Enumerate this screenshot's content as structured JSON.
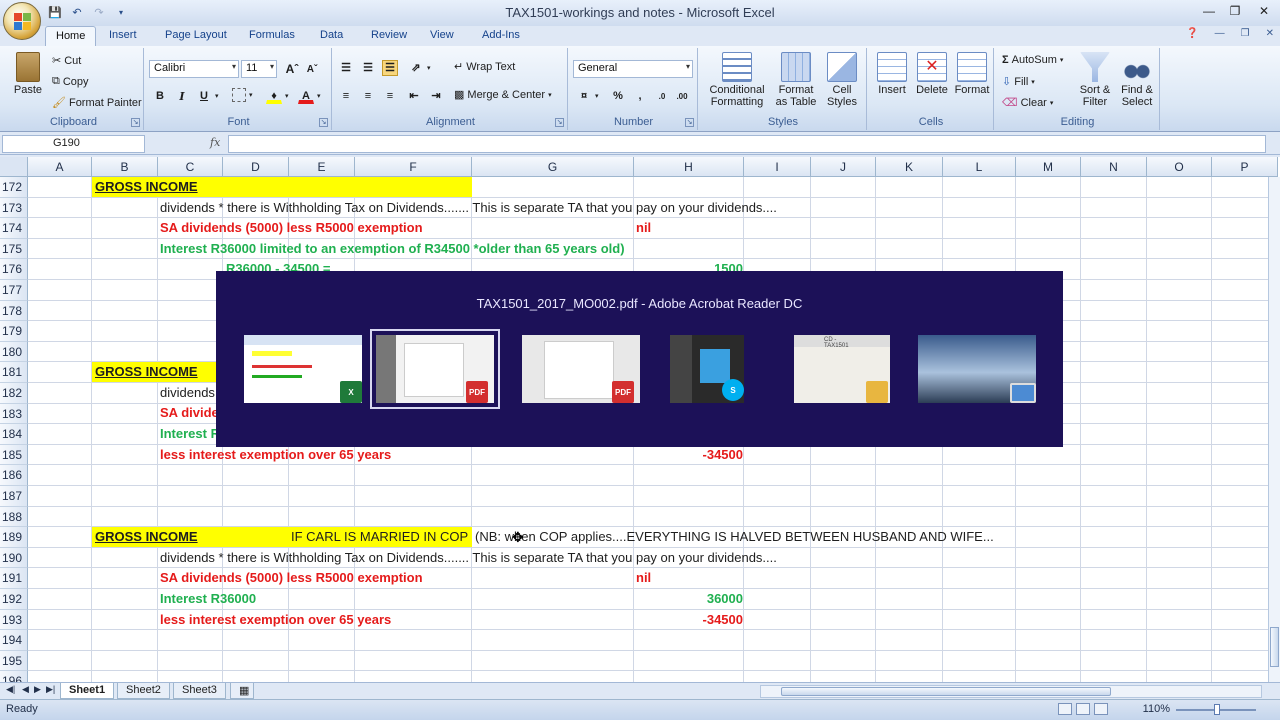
{
  "window": {
    "title": "TAX1501-workings and notes - Microsoft Excel"
  },
  "ribbon": {
    "tabs": [
      "Home",
      "Insert",
      "Page Layout",
      "Formulas",
      "Data",
      "Review",
      "View",
      "Add-Ins"
    ],
    "clipboard": {
      "paste": "Paste",
      "cut": "Cut",
      "copy": "Copy",
      "format_painter": "Format Painter",
      "label": "Clipboard"
    },
    "font": {
      "name": "Calibri",
      "size": "11",
      "label": "Font"
    },
    "alignment": {
      "wrap_text": "Wrap Text",
      "merge_center": "Merge & Center",
      "label": "Alignment"
    },
    "number": {
      "format": "General",
      "percent": "%",
      "comma": ",",
      "label": "Number"
    },
    "styles": {
      "conditional": "Conditional Formatting",
      "format_table": "Format as Table",
      "cell_styles": "Cell Styles",
      "label": "Styles"
    },
    "cells": {
      "insert": "Insert",
      "delete": "Delete",
      "format": "Format",
      "label": "Cells"
    },
    "editing": {
      "autosum": "AutoSum",
      "fill": "Fill",
      "clear": "Clear",
      "sort_filter": "Sort & Filter",
      "find_select": "Find & Select",
      "label": "Editing"
    }
  },
  "formula_bar": {
    "name_box": "G190",
    "fx": "fx",
    "value": ""
  },
  "columns": [
    "A",
    "B",
    "C",
    "D",
    "E",
    "F",
    "G",
    "H",
    "I",
    "J",
    "K",
    "L",
    "M",
    "N",
    "O",
    "P"
  ],
  "rows": [
    "172",
    "173",
    "174",
    "175",
    "176",
    "177",
    "178",
    "179",
    "180",
    "181",
    "182",
    "183",
    "184",
    "185",
    "186",
    "187",
    "188",
    "189",
    "190",
    "191",
    "192",
    "193",
    "194",
    "195",
    "196"
  ],
  "cells": {
    "r172_b": "GROSS INCOME",
    "r173_c": "dividends  * there is Withholding Tax on Dividends....... This is separate TA that you pay on your dividends....",
    "r174_c": "SA dividends (5000)  less R5000 exemption",
    "r174_g": "nil",
    "r175_c": "Interest R36000 limited to an exemption of R34500 *older than 65 years old)",
    "r176_d": "R36000 - 34500 =",
    "r176_h": "1500",
    "r181_b": "GROSS INCOME",
    "r182_c": "dividends",
    "r183_c": "SA divide",
    "r184_c": "Interest R",
    "r185_c": "less interest exemption over 65 years",
    "r185_h": "-34500",
    "r189_b": "GROSS INCOME",
    "r189_e": "IF CARL IS MARRIED IN COP",
    "r189_g": "(NB: when COP applies....EVERYTHING IS HALVED BETWEEN HUSBAND AND WIFE...",
    "r190_c": "dividends  * there is Withholding Tax on Dividends....... This is separate TA that you pay on your dividends....",
    "r191_c": "SA dividends (5000)  less R5000 exemption",
    "r191_g": "nil",
    "r192_c": "Interest R36000",
    "r192_h": "36000",
    "r193_c": "less interest exemption over 65 years",
    "r193_h": "-34500"
  },
  "sheets": [
    "Sheet1",
    "Sheet2",
    "Sheet3"
  ],
  "status": {
    "ready": "Ready",
    "zoom": "110%"
  },
  "task_switcher": {
    "title": "TAX1501_2017_MO002.pdf - Adobe Acrobat Reader DC",
    "thumbnails": [
      {
        "app": "excel-window",
        "badge": "excel-icon"
      },
      {
        "app": "acrobat-window-selected",
        "badge": "pdf-icon"
      },
      {
        "app": "acrobat-window",
        "badge": "pdf-icon"
      },
      {
        "app": "skype-window",
        "badge": "skype-icon"
      },
      {
        "app": "explorer-window",
        "badge": "folder-icon",
        "caption": "CD - TAX1501"
      },
      {
        "app": "desktop",
        "badge": "desktop-icon"
      }
    ]
  },
  "colors": {
    "yellow_fill": "#ffff00",
    "red_text": "#e51b1b",
    "green_text": "#20b050",
    "switcher_bg": "#1c1158"
  }
}
